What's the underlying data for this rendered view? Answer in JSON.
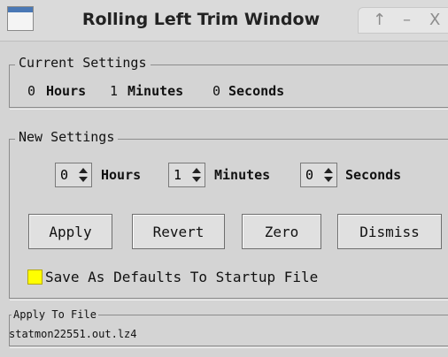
{
  "window": {
    "title": "Rolling Left Trim Window",
    "controls": {
      "up_icon": "↑",
      "minimize_icon": "–",
      "close_icon": "X"
    }
  },
  "current_settings": {
    "legend": "Current Settings",
    "hours_value": "0",
    "hours_label": "Hours",
    "minutes_value": "1",
    "minutes_label": "Minutes",
    "seconds_value": "0",
    "seconds_label": "Seconds"
  },
  "new_settings": {
    "legend": "New Settings",
    "hours_value": "0",
    "hours_label": "Hours",
    "minutes_value": "1",
    "minutes_label": "Minutes",
    "seconds_value": "0",
    "seconds_label": "Seconds"
  },
  "buttons": {
    "apply": "Apply",
    "revert": "Revert",
    "zero": "Zero",
    "dismiss": "Dismiss"
  },
  "defaults": {
    "label": "Save As Defaults To Startup File",
    "checkbox_color": "#ffff00"
  },
  "apply_to_file": {
    "legend": "Apply To File",
    "filename": "statmon22551.out.lz4"
  }
}
